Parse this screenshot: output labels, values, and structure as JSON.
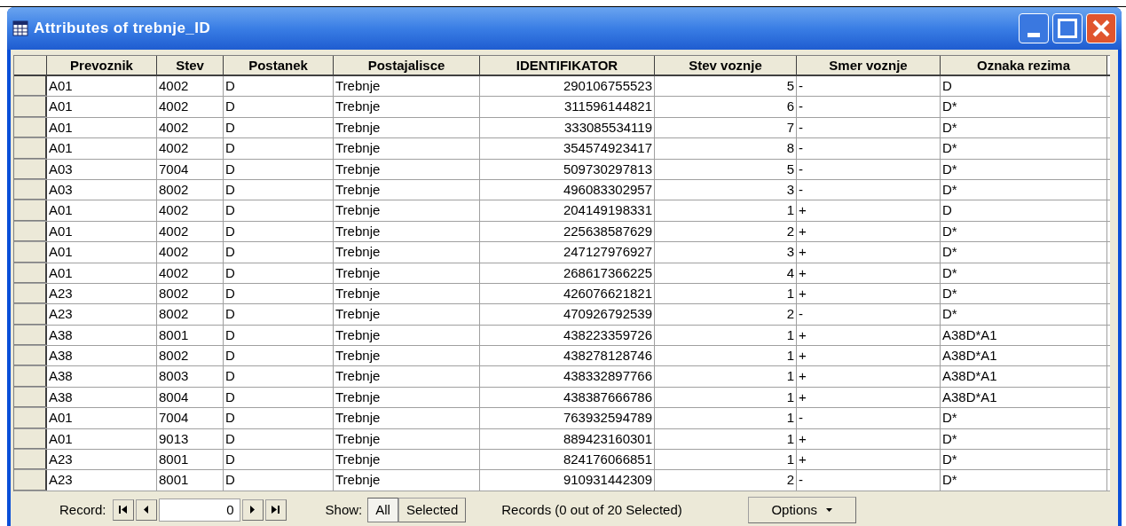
{
  "window": {
    "title": "Attributes of trebnje_ID"
  },
  "table": {
    "columns": [
      {
        "label": "Prevoznik",
        "kind": "text"
      },
      {
        "label": "Stev",
        "kind": "text"
      },
      {
        "label": "Postanek",
        "kind": "text"
      },
      {
        "label": "Postajalisce",
        "kind": "text"
      },
      {
        "label": "IDENTIFIKATOR",
        "kind": "number"
      },
      {
        "label": "Stev voznje",
        "kind": "number"
      },
      {
        "label": "Smer voznje",
        "kind": "text"
      },
      {
        "label": "Oznaka rezima",
        "kind": "text"
      }
    ],
    "rows": [
      [
        "A01",
        "4002",
        "D",
        "Trebnje",
        "290106755523",
        "5",
        "-",
        "D"
      ],
      [
        "A01",
        "4002",
        "D",
        "Trebnje",
        "311596144821",
        "6",
        "-",
        "D*"
      ],
      [
        "A01",
        "4002",
        "D",
        "Trebnje",
        "333085534119",
        "7",
        "-",
        "D*"
      ],
      [
        "A01",
        "4002",
        "D",
        "Trebnje",
        "354574923417",
        "8",
        "-",
        "D*"
      ],
      [
        "A03",
        "7004",
        "D",
        "Trebnje",
        "509730297813",
        "5",
        "-",
        "D*"
      ],
      [
        "A03",
        "8002",
        "D",
        "Trebnje",
        "496083302957",
        "3",
        "-",
        "D*"
      ],
      [
        "A01",
        "4002",
        "D",
        "Trebnje",
        "204149198331",
        "1",
        "+",
        "D"
      ],
      [
        "A01",
        "4002",
        "D",
        "Trebnje",
        "225638587629",
        "2",
        "+",
        "D*"
      ],
      [
        "A01",
        "4002",
        "D",
        "Trebnje",
        "247127976927",
        "3",
        "+",
        "D*"
      ],
      [
        "A01",
        "4002",
        "D",
        "Trebnje",
        "268617366225",
        "4",
        "+",
        "D*"
      ],
      [
        "A23",
        "8002",
        "D",
        "Trebnje",
        "426076621821",
        "1",
        "+",
        "D*"
      ],
      [
        "A23",
        "8002",
        "D",
        "Trebnje",
        "470926792539",
        "2",
        "-",
        "D*"
      ],
      [
        "A38",
        "8001",
        "D",
        "Trebnje",
        "438223359726",
        "1",
        "+",
        "A38D*A1"
      ],
      [
        "A38",
        "8002",
        "D",
        "Trebnje",
        "438278128746",
        "1",
        "+",
        "A38D*A1"
      ],
      [
        "A38",
        "8003",
        "D",
        "Trebnje",
        "438332897766",
        "1",
        "+",
        "A38D*A1"
      ],
      [
        "A38",
        "8004",
        "D",
        "Trebnje",
        "438387666786",
        "1",
        "+",
        "A38D*A1"
      ],
      [
        "A01",
        "7004",
        "D",
        "Trebnje",
        "763932594789",
        "1",
        "-",
        "D*"
      ],
      [
        "A01",
        "9013",
        "D",
        "Trebnje",
        "889423160301",
        "1",
        "+",
        "D*"
      ],
      [
        "A23",
        "8001",
        "D",
        "Trebnje",
        "824176066851",
        "1",
        "+",
        "D*"
      ],
      [
        "A23",
        "8001",
        "D",
        "Trebnje",
        "910931442309",
        "2",
        "-",
        "D*"
      ]
    ]
  },
  "footer": {
    "record_label": "Record:",
    "record_value": "0",
    "show_label": "Show:",
    "show_options": [
      {
        "label": "All",
        "selected": true
      },
      {
        "label": "Selected",
        "selected": false
      }
    ],
    "status": "Records (0 out of 20 Selected)",
    "options_button": "Options"
  }
}
